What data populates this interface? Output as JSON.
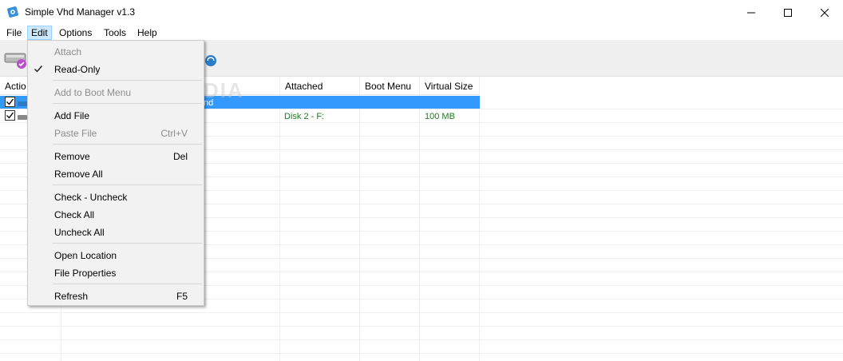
{
  "window": {
    "title": "Simple Vhd Manager v1.3"
  },
  "menubar": {
    "items": [
      {
        "label": "File"
      },
      {
        "label": "Edit",
        "active": true
      },
      {
        "label": "Options"
      },
      {
        "label": "Tools"
      },
      {
        "label": "Help"
      }
    ]
  },
  "grid": {
    "columns": [
      {
        "label": "Actio"
      },
      {
        "label": ""
      },
      {
        "label": "Attached"
      },
      {
        "label": "Boot Menu"
      },
      {
        "label": "Virtual Size"
      }
    ],
    "rows": [
      {
        "checked": true,
        "selected": true,
        "name_fragment": "nd",
        "attached": "",
        "boot_menu": "",
        "virtual_size": ""
      },
      {
        "checked": true,
        "selected": false,
        "name_fragment": "",
        "attached": "Disk 2  -  F:",
        "boot_menu": "",
        "virtual_size": "100 MB"
      }
    ]
  },
  "edit_menu": {
    "attach": "Attach",
    "read_only": "Read-Only",
    "add_to_boot_menu": "Add to Boot Menu",
    "add_file": "Add File",
    "paste_file": "Paste File",
    "paste_file_shortcut": "Ctrl+V",
    "remove": "Remove",
    "remove_shortcut": "Del",
    "remove_all": "Remove All",
    "check_uncheck": "Check - Uncheck",
    "check_all": "Check All",
    "uncheck_all": "Uncheck All",
    "open_location": "Open Location",
    "file_properties": "File Properties",
    "refresh": "Refresh",
    "refresh_shortcut": "F5"
  },
  "watermark": "SOFTPEDIA",
  "colors": {
    "selection": "#3399ff",
    "menu_active": "#cce8ff",
    "attached_text": "#1e7d1e",
    "menu_bg": "#f2f2f2"
  }
}
